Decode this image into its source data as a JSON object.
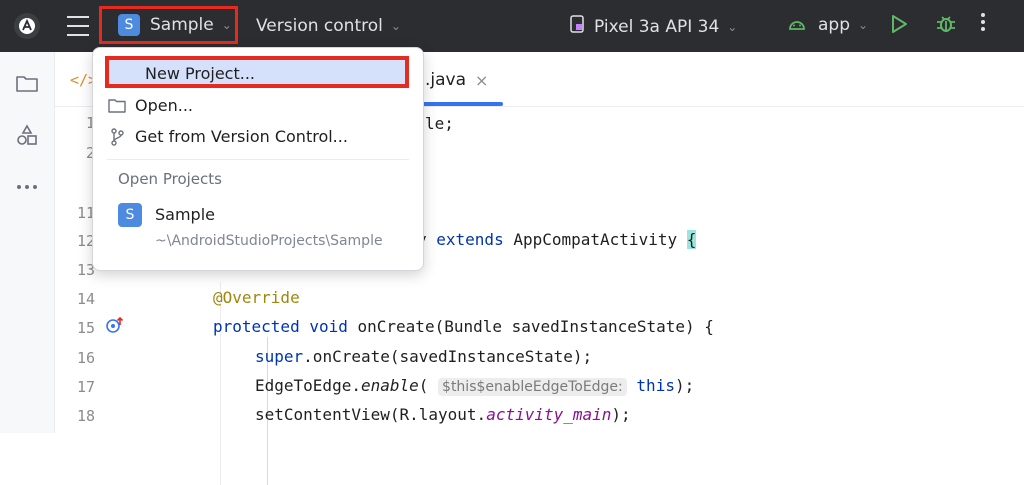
{
  "toolbar": {
    "logo_glyph": "A",
    "project_badge": "S",
    "project_name": "Sample",
    "version_control": "Version control",
    "device": "Pixel 3a API 34",
    "run_config": "app",
    "chevron": "⌄"
  },
  "sidebar": {
    "items": [
      {
        "icon": "folder-icon"
      },
      {
        "icon": "resource-manager-icon"
      },
      {
        "icon": "more-icon"
      }
    ]
  },
  "editor": {
    "tab": {
      "label": ".java",
      "close": "×",
      "code_glyph": "</>"
    },
    "line_numbers": [
      "1",
      "2",
      "11",
      "12",
      "13",
      "14",
      "15",
      "16",
      "17",
      "18"
    ],
    "code": {
      "l1": "le;",
      "l12_a": "y ",
      "l12_kw": "extends",
      "l12_b": " AppCompatActivity ",
      "l12_brace": "{",
      "l14": "@Override",
      "l15_kw1": "protected",
      "l15_kw2": "void",
      "l15_rest": " onCreate(Bundle savedInstanceState) {",
      "l16_kw": "super",
      "l16_rest": ".onCreate(savedInstanceState);",
      "l17_a": "EdgeToEdge.",
      "l17_it": "enable",
      "l17_b": "( ",
      "l17_hint": "$this$enableEdgeToEdge:",
      "l17_kw": "this",
      "l17_c": ");",
      "l18_a": "setContentView(R.layout.",
      "l18_field": "activity_main",
      "l18_b": ");"
    }
  },
  "dropdown": {
    "new_project": "New Project...",
    "open": "Open...",
    "get_from_vc": "Get from Version Control...",
    "section": "Open Projects",
    "recent_badge": "S",
    "recent_name": "Sample",
    "recent_path": "~\\AndroidStudioProjects\\Sample"
  },
  "colors": {
    "toolbar_bg": "#2b2d30",
    "highlight_border": "#e52b20",
    "selected_item": "#d5e1fb",
    "accent": "#3574f0"
  }
}
